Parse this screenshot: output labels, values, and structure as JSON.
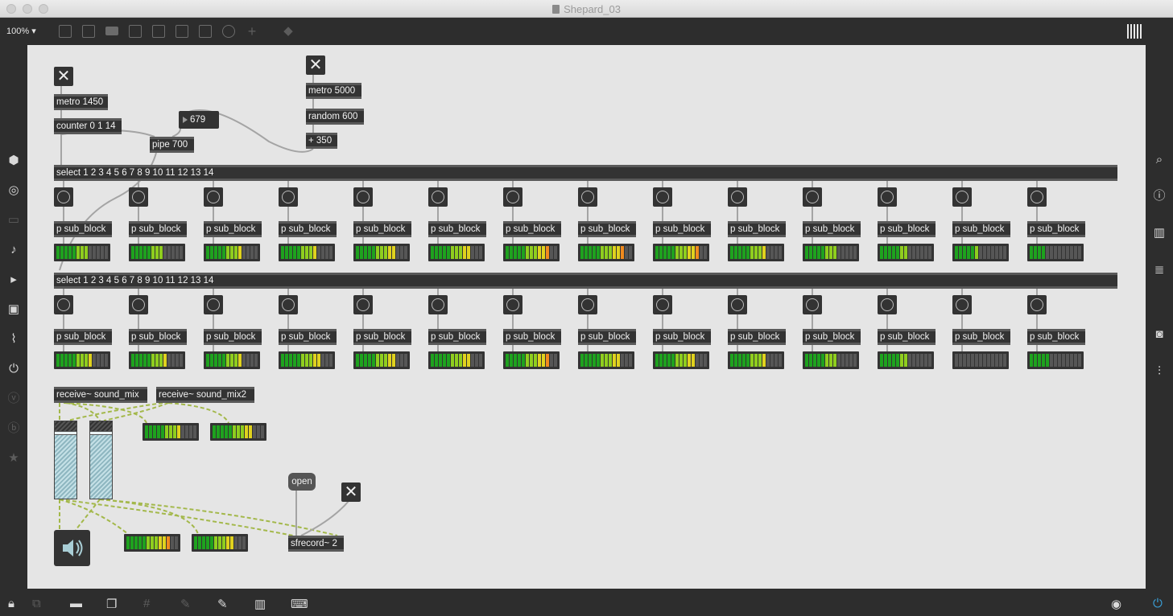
{
  "window": {
    "title": "Shepard_03"
  },
  "toolbar": {
    "zoom": "100%"
  },
  "left_sidebar": [
    "cube-icon",
    "target-icon",
    "presentation-icon",
    "note-icon",
    "step-icon",
    "image-icon",
    "clip-icon",
    "plug-icon",
    "v-icon",
    "b-icon",
    "star-icon"
  ],
  "right_sidebar": [
    "search-icon",
    "info-icon",
    "book-icon",
    "list-icon",
    "camera-icon",
    "sliders-icon"
  ],
  "patch": {
    "metro1": "metro 1450",
    "counter": "counter 0 1 14",
    "pipe": "pipe 700",
    "number": "679",
    "metro2": "metro 5000",
    "random": "random 600",
    "plus": "+ 350",
    "select1": "select 1 2 3 4 5 6 7 8 9 10 11 12 13 14",
    "select2": "select 1 2 3 4 5 6 7 8 9 10 11 12 13 14",
    "subblock": "p sub_block",
    "receive1": "receive~ sound_mix",
    "receive2": "receive~ sound_mix2",
    "open_msg": "open",
    "sfrecord": "sfrecord~ 2"
  },
  "meters_row1": [
    8,
    8,
    9,
    9,
    10,
    10,
    11,
    11,
    11,
    9,
    8,
    7,
    6,
    4
  ],
  "meters_row2": [
    9,
    9,
    9,
    10,
    10,
    10,
    11,
    10,
    10,
    9,
    8,
    7,
    0,
    5
  ],
  "meters_mix": [
    9,
    10,
    11,
    10
  ],
  "colors": {
    "canvas": "#e5e5e5",
    "object": "#333333",
    "accent": "#3aa0d8"
  }
}
